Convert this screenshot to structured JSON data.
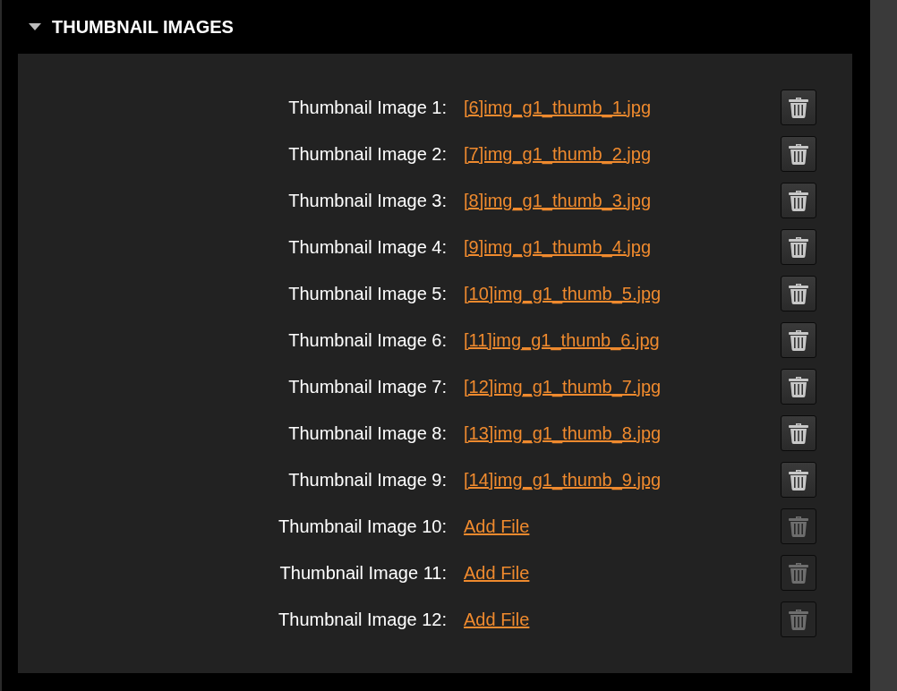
{
  "section": {
    "title": "THUMBNAIL IMAGES",
    "expanded": true
  },
  "rows": [
    {
      "label": "Thumbnail Image 1:",
      "file": "[6]img_g1_thumb_1.jpg",
      "delete_enabled": true
    },
    {
      "label": "Thumbnail Image 2:",
      "file": "[7]img_g1_thumb_2.jpg",
      "delete_enabled": true
    },
    {
      "label": "Thumbnail Image 3:",
      "file": "[8]img_g1_thumb_3.jpg",
      "delete_enabled": true
    },
    {
      "label": "Thumbnail Image 4:",
      "file": "[9]img_g1_thumb_4.jpg",
      "delete_enabled": true
    },
    {
      "label": "Thumbnail Image 5:",
      "file": "[10]img_g1_thumb_5.jpg",
      "delete_enabled": true
    },
    {
      "label": "Thumbnail Image 6:",
      "file": "[11]img_g1_thumb_6.jpg",
      "delete_enabled": true
    },
    {
      "label": "Thumbnail Image 7:",
      "file": "[12]img_g1_thumb_7.jpg",
      "delete_enabled": true
    },
    {
      "label": "Thumbnail Image 8:",
      "file": "[13]img_g1_thumb_8.jpg",
      "delete_enabled": true
    },
    {
      "label": "Thumbnail Image 9:",
      "file": "[14]img_g1_thumb_9.jpg",
      "delete_enabled": true
    },
    {
      "label": "Thumbnail Image 10:",
      "file": "Add File",
      "delete_enabled": false
    },
    {
      "label": "Thumbnail Image 11:",
      "file": "Add File",
      "delete_enabled": false
    },
    {
      "label": "Thumbnail Image 12:",
      "file": "Add File",
      "delete_enabled": false
    }
  ]
}
